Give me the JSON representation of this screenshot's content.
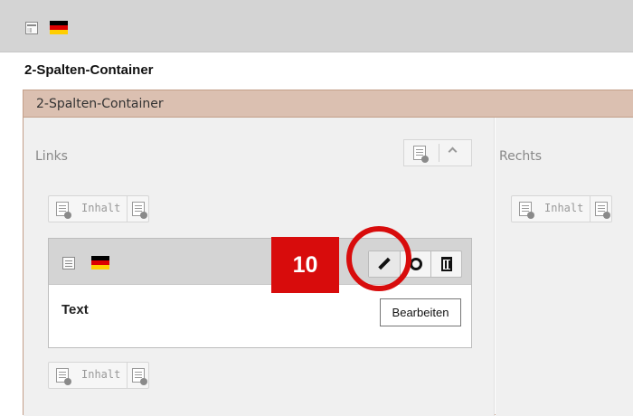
{
  "header": {
    "language_flag": "germany-flag",
    "page_icon": "page-icon"
  },
  "section_title": "2-Spalten-Container",
  "container": {
    "title": "2-Spalten-Container",
    "columns": [
      {
        "title": "Links",
        "new_content_label": "Inhalt"
      },
      {
        "title": "Rechts",
        "new_content_label": "Inhalt"
      }
    ]
  },
  "content_element": {
    "title": "Text",
    "buttons": {
      "edit_tooltip": "Bearbeiten"
    }
  },
  "annotation": {
    "step_number": "10",
    "color": "#d80c0c"
  }
}
